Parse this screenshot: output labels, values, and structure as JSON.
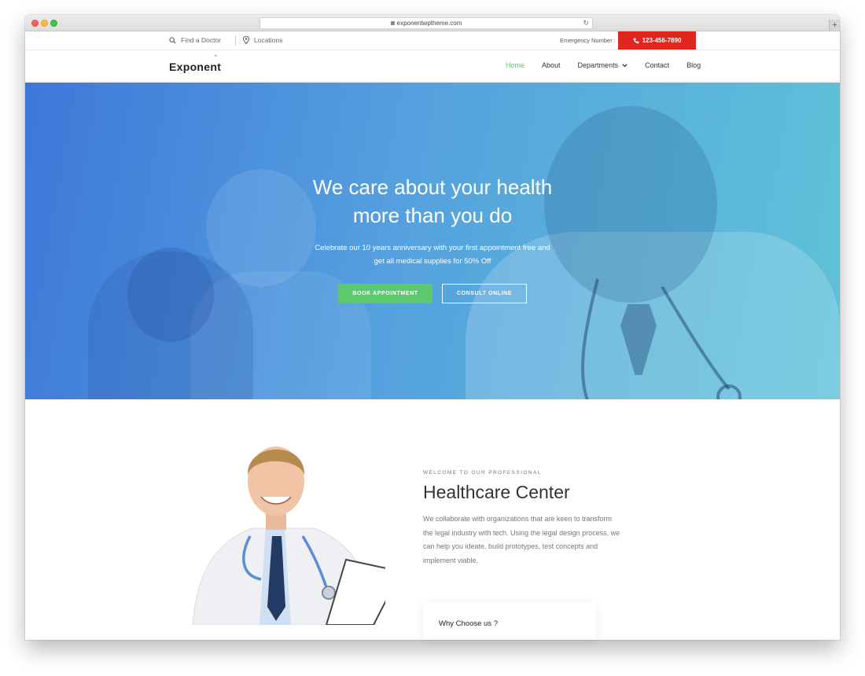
{
  "browser": {
    "url": "exponentwptheme.com"
  },
  "infobar": {
    "find_doctor": "Find a Doctor",
    "locations": "Locations",
    "emergency_label": "Emergency Number :",
    "phone": "123-456-7890"
  },
  "nav": {
    "logo": "Exponent",
    "items": [
      {
        "label": "Home",
        "active": true
      },
      {
        "label": "About",
        "active": false
      },
      {
        "label": "Departments",
        "active": false
      },
      {
        "label": "Contact",
        "active": false
      },
      {
        "label": "Blog",
        "active": false
      }
    ]
  },
  "hero": {
    "title_line1": "We care about your health",
    "title_line2": "more than you do",
    "subtitle_line1": "Celebrate our 10 years anniversary with your first appointment free and",
    "subtitle_line2": "get all medical supplies for 50% Off",
    "primary_button": "BOOK APPOINTMENT",
    "secondary_button": "CONSULT ONLINE"
  },
  "about": {
    "eyebrow": "WELCOME TO OUR PROFESSIONAL",
    "title": "Healthcare Center",
    "body_lines": [
      "We collaborate with organizations that are keen to transform",
      "the legal industry with tech. Using the legal design process, we",
      "can help you ideate, build prototypes, test concepts and",
      "implement viable."
    ],
    "card_title": "Why Choose us ?"
  },
  "colors": {
    "accent_green": "#5cc96d",
    "emergency_red": "#e0261e",
    "hero_blue_left": "#3d78d8",
    "hero_teal_right": "#5ec2d8"
  }
}
